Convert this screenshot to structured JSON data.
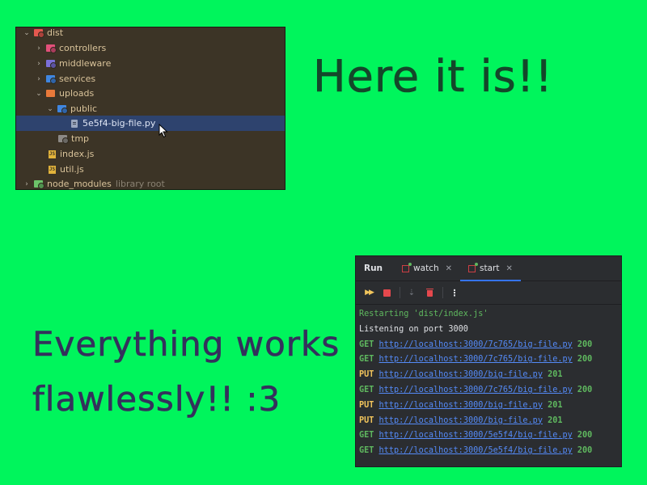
{
  "file_tree": {
    "rows": [
      {
        "label": "dist",
        "icon": "folder-red",
        "expanded": true
      },
      {
        "label": "controllers",
        "icon": "folder-pink",
        "expanded": false
      },
      {
        "label": "middleware",
        "icon": "folder-purple",
        "expanded": false
      },
      {
        "label": "services",
        "icon": "folder-blue",
        "expanded": false
      },
      {
        "label": "uploads",
        "icon": "folder-orange",
        "expanded": true
      },
      {
        "label": "public",
        "icon": "folder-blue",
        "expanded": true
      },
      {
        "label": "5e5f4-big-file.py",
        "icon": "python-file",
        "selected": true
      },
      {
        "label": "tmp",
        "icon": "folder-gray"
      },
      {
        "label": "index.js",
        "icon": "js-file"
      },
      {
        "label": "util.js",
        "icon": "js-file"
      },
      {
        "label": "node_modules",
        "icon": "folder-green",
        "note": "library root"
      }
    ]
  },
  "captions": {
    "top": "Here it is!!",
    "bottom_line1": "Everything works",
    "bottom_line2": "flawlessly!! :3"
  },
  "run_panel": {
    "title": "Run",
    "tabs": [
      {
        "label": "watch",
        "icon": "npm-icon"
      },
      {
        "label": "start",
        "icon": "npm-icon",
        "active": true
      }
    ],
    "console": {
      "status": "Restarting 'dist/index.js'",
      "listening": "Listening on port 3000",
      "requests": [
        {
          "method": "GET",
          "url": "http://localhost:3000/7c765/big-file.py",
          "code": "200"
        },
        {
          "method": "GET",
          "url": "http://localhost:3000/7c765/big-file.py",
          "code": "200"
        },
        {
          "method": "PUT",
          "url": "http://localhost:3000/big-file.py",
          "code": "201"
        },
        {
          "method": "GET",
          "url": "http://localhost:3000/7c765/big-file.py",
          "code": "200"
        },
        {
          "method": "PUT",
          "url": "http://localhost:3000/big-file.py",
          "code": "201"
        },
        {
          "method": "PUT",
          "url": "http://localhost:3000/big-file.py",
          "code": "201"
        },
        {
          "method": "GET",
          "url": "http://localhost:3000/5e5f4/big-file.py",
          "code": "200"
        },
        {
          "method": "GET",
          "url": "http://localhost:3000/5e5f4/big-file.py",
          "code": "200"
        }
      ]
    }
  },
  "colors": {
    "background": "#00f55c",
    "tree_background": "#3c3426",
    "selection": "#2e436e",
    "console_background": "#2b2d30",
    "link": "#548af7",
    "ok": "#5fb85f",
    "put": "#f2c55c"
  }
}
